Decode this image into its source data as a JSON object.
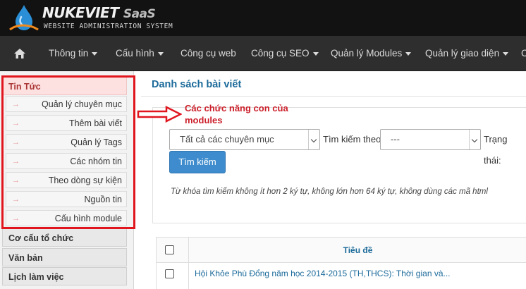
{
  "brand": {
    "name": "NUKEVIET",
    "suffix": "SaaS",
    "tagline": "WEBSITE ADMINISTRATION SYSTEM"
  },
  "nav": {
    "items": [
      {
        "label": "Thông tin",
        "has_caret": true
      },
      {
        "label": "Cấu hình",
        "has_caret": true
      },
      {
        "label": "Công cụ web",
        "has_caret": false
      },
      {
        "label": "Công cụ SEO",
        "has_caret": true
      },
      {
        "label": "Quản lý Modules",
        "has_caret": true
      },
      {
        "label": "Quản lý giao diện",
        "has_caret": true
      },
      {
        "label": "C",
        "has_caret": false
      }
    ]
  },
  "sidebar": {
    "active_module": "Tin Tức",
    "sub_items": [
      "Quản lý chuyên mục",
      "Thêm bài viết",
      "Quản lý Tags",
      "Các nhóm tin",
      "Theo dòng sự kiện",
      "Nguồn tin",
      "Cấu hình module"
    ],
    "modules": [
      "Cơ cấu tổ chức",
      "Văn bản",
      "Lịch làm việc"
    ]
  },
  "main": {
    "title": "Danh sách bài viết",
    "annotation": "Các chức năng con của modules",
    "filter": {
      "category_value": "Tất cả các chuyên mục",
      "search_by_label": "Tìm kiếm theo:",
      "search_by_value": "---",
      "status_label": "Trạng thái:",
      "search_button": "Tìm kiếm",
      "hint": "Từ khóa tìm kiếm không ít hơn 2 ký tự, không lớn hơn 64 ký tự, không dùng các mã html"
    },
    "table": {
      "header_title": "Tiêu đề",
      "rows": [
        "Hội Khỏe Phù Đổng năm học 2014-2015 (TH,THCS): Thời gian và..."
      ]
    }
  },
  "colors": {
    "header_bg": "#121212",
    "nav_bg": "#2e2e2e",
    "accent_blue": "#1b6a9a",
    "button_blue": "#3e8ccd",
    "annotation_red": "#e0151e"
  }
}
